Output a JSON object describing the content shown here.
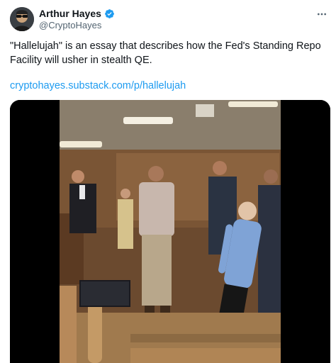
{
  "tweet": {
    "author": {
      "display_name": "Arthur Hayes",
      "handle": "@CryptoHayes",
      "verified": true,
      "avatar_icon": "avatar-icon"
    },
    "text": "\"Hallelujah\" is an essay that describes how the Fed's Standing Repo Facility will usher in stealth QE.",
    "link_text": "cryptohayes.substack.com/p/hallelujah",
    "more_icon": "more-options-icon",
    "media": {
      "type": "video",
      "icon": "video-frame"
    }
  },
  "colors": {
    "text": "#0f1419",
    "secondary": "#536471",
    "link": "#1d9bf0",
    "verified": "#1d9bf0"
  }
}
